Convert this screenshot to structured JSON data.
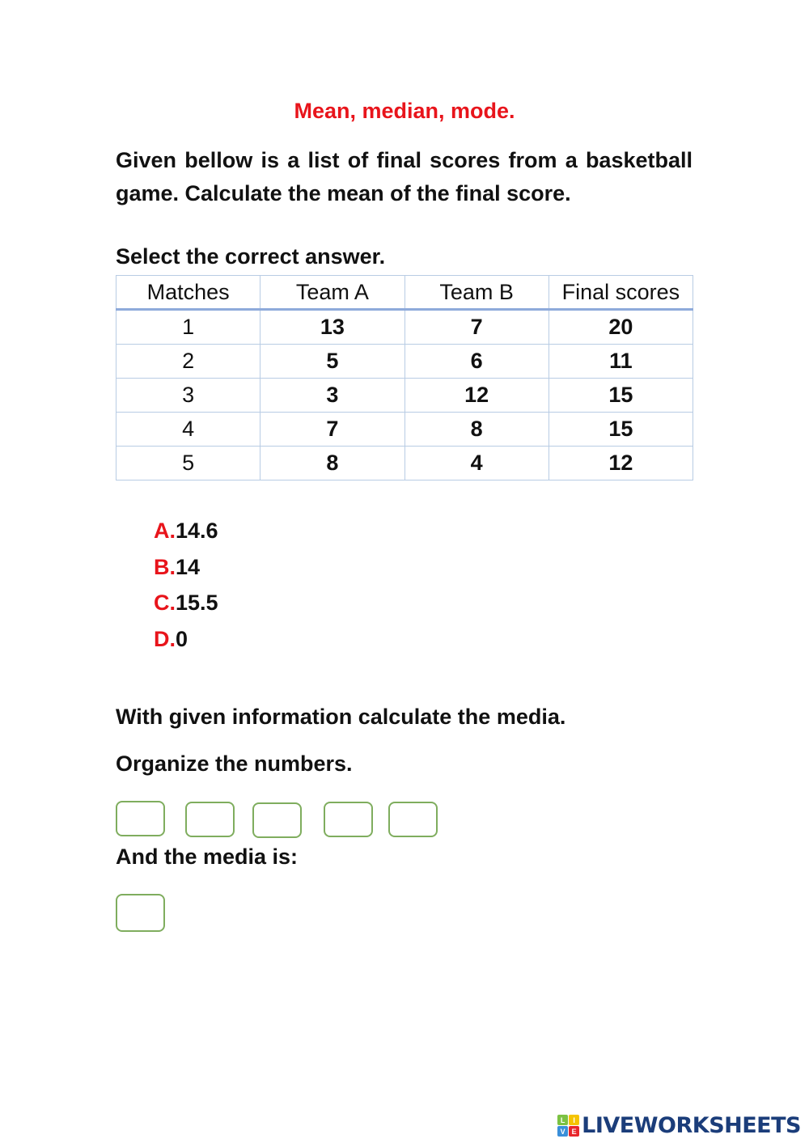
{
  "title": "Mean, median, mode.",
  "question1": {
    "text": "Given bellow is a list of final scores from a basketball game. Calculate the mean of the final score.",
    "instruction": "Select the correct answer."
  },
  "table": {
    "headers": [
      "Matches",
      "Team A",
      "Team B",
      "Final scores"
    ],
    "rows": [
      [
        "1",
        "13",
        "7",
        "20"
      ],
      [
        "2",
        "5",
        "6",
        "11"
      ],
      [
        "3",
        "3",
        "12",
        "15"
      ],
      [
        "4",
        "7",
        "8",
        "15"
      ],
      [
        "5",
        "8",
        "4",
        "12"
      ]
    ]
  },
  "options": [
    {
      "letter": "A.",
      "value": "14.6"
    },
    {
      "letter": "B.",
      "value": "14"
    },
    {
      "letter": "C.",
      "value": "15.5"
    },
    {
      "letter": "D.",
      "value": "0"
    }
  ],
  "question2": {
    "text": "With given information calculate the media.",
    "organize": "Organize the numbers.",
    "media_label": "And the media is:",
    "order_boxes": [
      "",
      "",
      "",
      "",
      ""
    ],
    "media_box": ""
  },
  "branding": {
    "logo_letters": [
      "L",
      "I",
      "V",
      "E"
    ],
    "logo_colors": [
      "#7cc243",
      "#f5c400",
      "#3a8fd9",
      "#e8262b"
    ],
    "logo_text": "LIVEWORKSHEETS"
  }
}
